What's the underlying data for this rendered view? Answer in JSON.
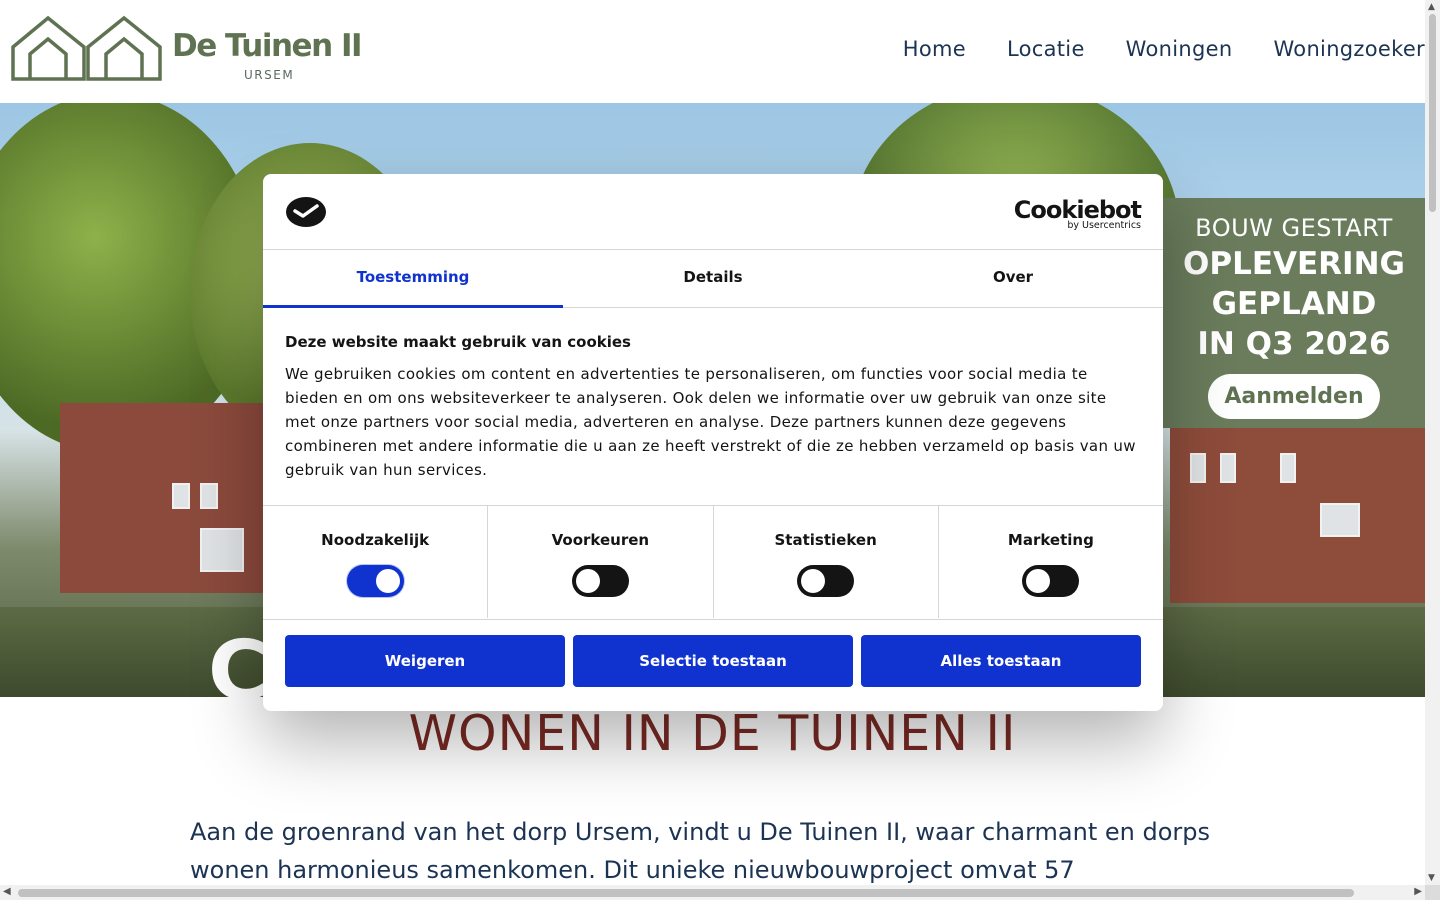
{
  "header": {
    "logo_title": "De Tuinen II",
    "logo_subtitle": "URSEM",
    "nav": [
      "Home",
      "Locatie",
      "Woningen",
      "Woningzoeker"
    ]
  },
  "hero": {
    "heading_partial": "C                              S",
    "badge": {
      "line1": "BOUW GESTART",
      "line2": "OPLEVERING",
      "line3": "GEPLAND",
      "line4": "IN Q3 2026",
      "button": "Aanmelden"
    }
  },
  "content": {
    "sub_heading": "WONEN IN DE TUINEN II",
    "intro": "Aan de groenrand van het dorp Ursem, vindt u De Tuinen II, waar charmant en dorps wonen harmonieus samenkomen. Dit unieke nieuwbouwproject omvat 57"
  },
  "cookie": {
    "brand": "Cookiebot",
    "brand_sub": "by Usercentrics",
    "tabs": [
      "Toestemming",
      "Details",
      "Over"
    ],
    "title": "Deze website maakt gebruik van cookies",
    "body": "We gebruiken cookies om content en advertenties te personaliseren, om functies voor social media te bieden en om ons websiteverkeer te analyseren. Ook delen we informatie over uw gebruik van onze site met onze partners voor social media, adverteren en analyse. Deze partners kunnen deze gegevens combineren met andere informatie die u aan ze heeft verstrekt of die ze hebben verzameld op basis van uw gebruik van hun services.",
    "toggles": [
      {
        "label": "Noodzakelijk",
        "on": true
      },
      {
        "label": "Voorkeuren",
        "on": false
      },
      {
        "label": "Statistieken",
        "on": false
      },
      {
        "label": "Marketing",
        "on": false
      }
    ],
    "buttons": [
      "Weigeren",
      "Selectie toestaan",
      "Alles toestaan"
    ],
    "accent": "#1032cf"
  }
}
